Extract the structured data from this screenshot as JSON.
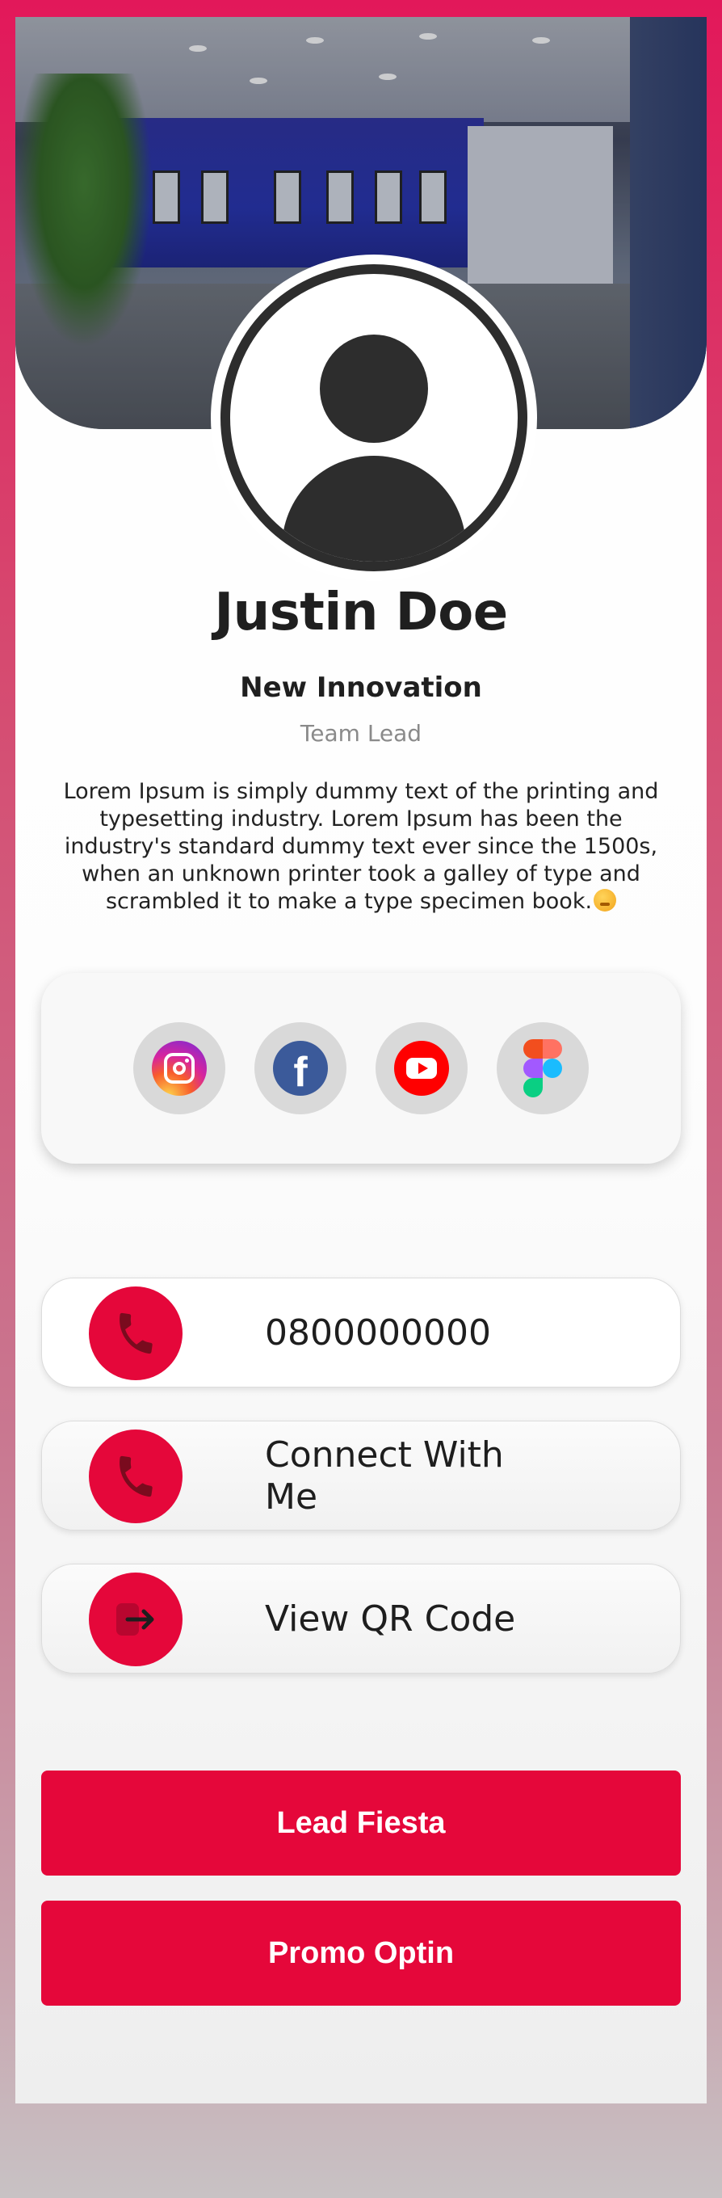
{
  "profile": {
    "name": "Justin Doe",
    "company": "New Innovation",
    "role": "Team Lead",
    "bio": "Lorem Ipsum is simply dummy text of the printing and typesetting industry. Lorem Ipsum has been the industry's standard dummy text ever since the 1500s, when an unknown printer took a galley of type and scrambled it to make a type specimen book."
  },
  "social": [
    {
      "icon": "instagram-icon"
    },
    {
      "icon": "facebook-icon",
      "glyph": "f"
    },
    {
      "icon": "youtube-icon"
    },
    {
      "icon": "figma-icon"
    }
  ],
  "actions": {
    "phone": "0800000000",
    "connect": "Connect With Me",
    "qr": "View QR Code"
  },
  "buttons": {
    "lead": "Lead Fiesta",
    "promo": "Promo Optin"
  },
  "colors": {
    "accent": "#e5073a",
    "text": "#1f1f1f",
    "muted": "#8a8a8a"
  }
}
